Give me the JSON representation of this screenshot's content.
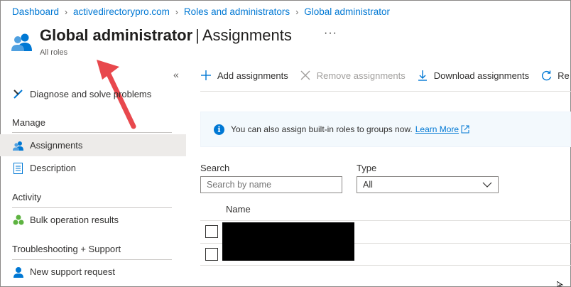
{
  "breadcrumb": [
    "Dashboard",
    "activedirectorypro.com",
    "Roles and administrators",
    "Global administrator"
  ],
  "header": {
    "title_main": "Global administrator",
    "title_sep": "|",
    "title_section": "Assignments",
    "more": "···",
    "subtitle": "All roles"
  },
  "sidebar": {
    "collapse": "«",
    "diagnose": "Diagnose and solve problems",
    "manage_heading": "Manage",
    "items_manage": [
      {
        "label": "Assignments",
        "icon": "users-icon"
      },
      {
        "label": "Description",
        "icon": "document-icon"
      }
    ],
    "activity_heading": "Activity",
    "bulk": "Bulk operation results",
    "support_heading": "Troubleshooting + Support",
    "support": "New support request"
  },
  "toolbar": {
    "add": "Add assignments",
    "remove": "Remove assignments",
    "download": "Download assignments",
    "refresh": "Re"
  },
  "banner": {
    "text": "You can also assign built-in roles to groups now.",
    "link": "Learn More"
  },
  "filters": {
    "search_label": "Search",
    "search_placeholder": "Search by name",
    "type_label": "Type",
    "type_value": "All"
  },
  "table": {
    "column_name": "Name"
  },
  "colors": {
    "accent": "#0078d4",
    "annotation_arrow": "#e8484d"
  }
}
